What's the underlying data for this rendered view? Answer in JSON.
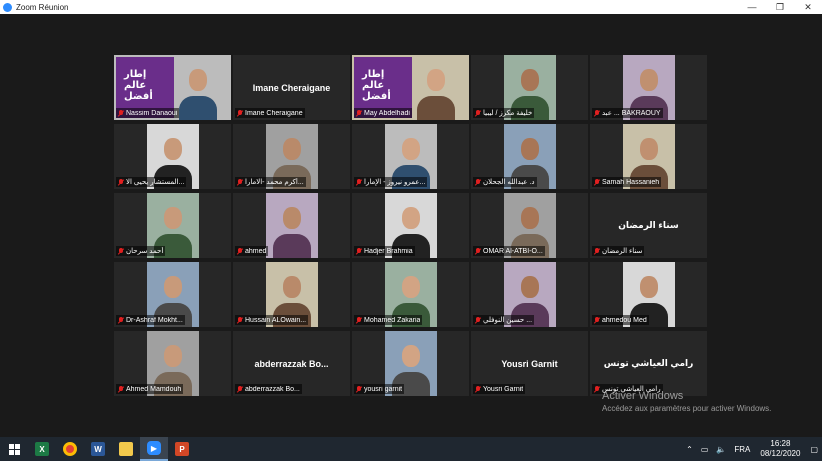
{
  "window": {
    "title": "Zoom Réunion"
  },
  "participants": [
    {
      "name": "Nassim Danaoui",
      "poster_text": "إطار عالم أفضل",
      "active": true
    },
    {
      "name": "Imane Cheraigane",
      "namecard": "Imane Cheraigane"
    },
    {
      "name": "May Abdelhadi",
      "poster_text": "إطار عالم أفضل"
    },
    {
      "name": "خليفة مكرز / ليبيا"
    },
    {
      "name": "عبد ... BAKRAOUY"
    },
    {
      "name": "المستشار يحيى الا..."
    },
    {
      "name": "أكرم محمد -الامارا..."
    },
    {
      "name": "عمرو نيروز - الإمارا..."
    },
    {
      "name": "د. عبدالله الجحلان"
    },
    {
      "name": "Samah Hassanieh"
    },
    {
      "name": "أحمد سرحان"
    },
    {
      "name": "ahmed"
    },
    {
      "name": "Hadjer Brahmia"
    },
    {
      "name": "OMAR Al-ATBI-O..."
    },
    {
      "name": "سناء الرمضان",
      "namecard": "سناء الرمضان"
    },
    {
      "name": "Dr-Ashraf Mokht..."
    },
    {
      "name": "Hussain ALOwain..."
    },
    {
      "name": "Mohamed Zakaria"
    },
    {
      "name": "حسين النوفلي ..."
    },
    {
      "name": "ahmedou Med"
    },
    {
      "name": "Ahmed Mamdouh"
    },
    {
      "name": "abderrazzak Bo...",
      "namecard": "abderrazzak  Bo..."
    },
    {
      "name": "yousri garnit"
    },
    {
      "name": "Yousri Garnit",
      "namecard": "Yousri Garnit"
    },
    {
      "name": "رامي العياشي تونس",
      "namecard": "رامي العياشي تونس"
    }
  ],
  "watermark": {
    "title": "Activer Windows",
    "subtitle": "Accédez aux paramètres pour activer Windows."
  },
  "taskbar": {
    "icons": [
      "windows-start",
      "excel",
      "chrome",
      "word",
      "file-explorer",
      "zoom",
      "powerpoint"
    ],
    "language": "FRA",
    "time": "16:28",
    "date": "08/12/2020"
  },
  "colors": {
    "active_border": "#e4e84a",
    "muted_mic": "#e02020",
    "poster": "#6a2e8a"
  }
}
